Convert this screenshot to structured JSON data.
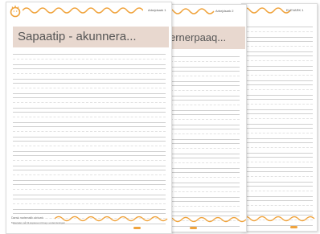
{
  "colors": {
    "accent": "#f0a33c",
    "banner": "#e8d8cf",
    "line": "#cfcfcf"
  },
  "icons": {
    "brand": "smiley-sun-icon"
  },
  "sheets": [
    {
      "label": "Arbejdsark 1",
      "banner": "Sapaatip - akunnera...",
      "footer": "Dansk matematik skrivark",
      "footer_fine": "Materialet må frit kopieres til brug i undervisningen",
      "logo": ""
    },
    {
      "label": "Arbejdsark 2",
      "banner": "ernerpaaq...",
      "logo": ""
    },
    {
      "label": "ELEVARK 1",
      "logo": ""
    }
  ]
}
